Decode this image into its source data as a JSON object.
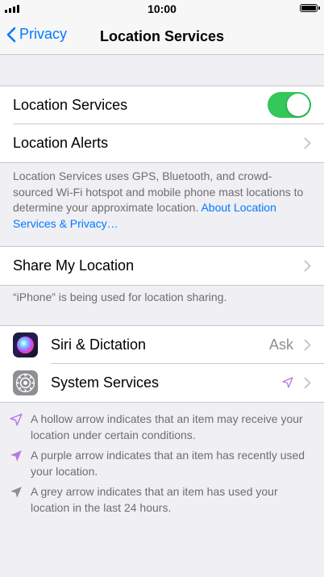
{
  "status": {
    "time": "10:00"
  },
  "nav": {
    "back_label": "Privacy",
    "title": "Location Services"
  },
  "group1": {
    "location_services_label": "Location Services",
    "location_services_on": true,
    "location_alerts_label": "Location Alerts"
  },
  "footnote1": {
    "text": "Location Services uses GPS, Bluetooth, and crowd-sourced Wi-Fi hotspot and mobile phone mast locations to determine your approximate location.",
    "link": "About Location Services & Privacy…"
  },
  "group2": {
    "share_label": "Share My Location"
  },
  "footnote2": {
    "text": "“iPhone” is being used for location sharing."
  },
  "apps": [
    {
      "name": "Siri & Dictation",
      "value": "Ask",
      "icon": "siri-icon"
    },
    {
      "name": "System Services",
      "value": "",
      "icon": "gear-icon",
      "indicator": "hollow-purple-arrow"
    }
  ],
  "legend": [
    {
      "icon": "hollow-arrow",
      "color": "#b57be0",
      "text": "A hollow arrow indicates that an item may receive your location under certain conditions."
    },
    {
      "icon": "purple-arrow",
      "color": "#b57be0",
      "text": "A purple arrow indicates that an item has recently used your location."
    },
    {
      "icon": "grey-arrow",
      "color": "#8e8e93",
      "text": "A grey arrow indicates that an item has used your location in the last 24 hours."
    }
  ],
  "colors": {
    "accent": "#007aff",
    "toggle_on": "#34c759",
    "background": "#efeff4"
  }
}
